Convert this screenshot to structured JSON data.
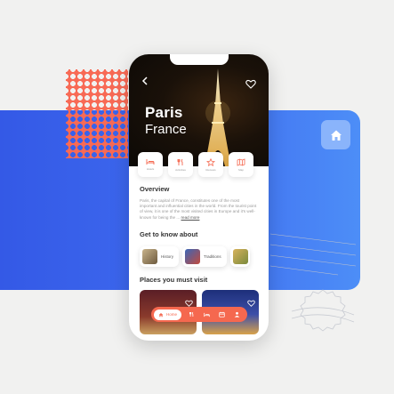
{
  "hero": {
    "city": "Paris",
    "country": "France"
  },
  "categories": [
    {
      "label": "Hotels",
      "icon": "bed-icon"
    },
    {
      "label": "Activities",
      "icon": "cutlery-icon"
    },
    {
      "label": "Reviews",
      "icon": "star-icon"
    },
    {
      "label": "Map",
      "icon": "map-icon"
    }
  ],
  "overview": {
    "title": "Overview",
    "text": "Paris, the capital of France, constitutes one of the most important and influential cities in the world. From the tourist point of view, it is one of the most visited cities in Europe and it's well-known for being the ...",
    "more": "read more"
  },
  "know": {
    "title": "Get to know about",
    "items": [
      "History",
      "Traditions",
      ""
    ]
  },
  "places": {
    "title": "Places you must visit"
  },
  "nav": {
    "home": "Home"
  },
  "colors": {
    "accent": "#f5684f",
    "blue": "#3f6cf0",
    "stamp": "#f86a55"
  }
}
